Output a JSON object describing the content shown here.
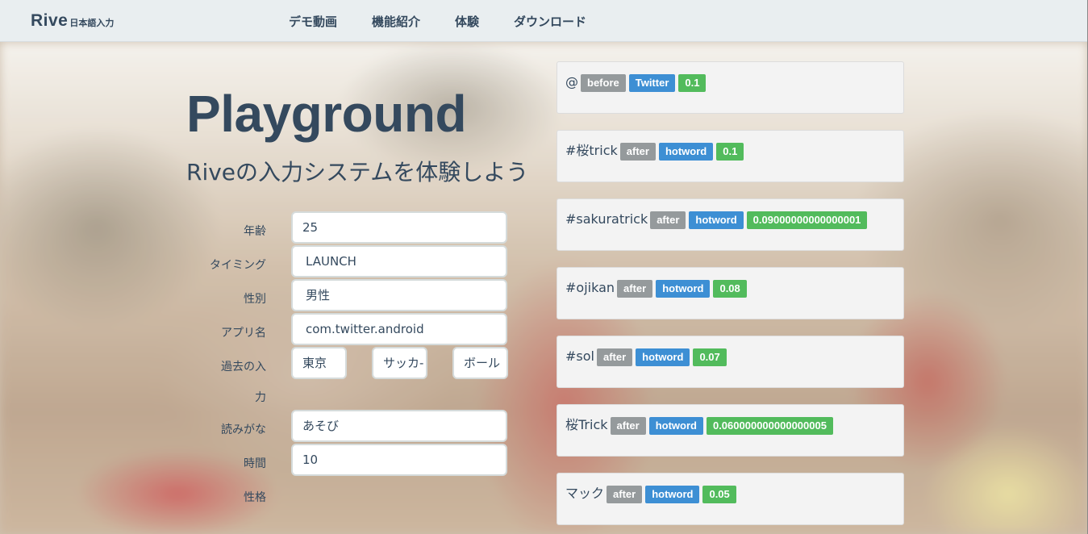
{
  "navbar": {
    "brand": "Rive",
    "brand_sub": "日本語入力",
    "links": [
      "デモ動画",
      "機能紹介",
      "体験",
      "ダウンロード"
    ]
  },
  "hero": {
    "title": "Playground",
    "subtitle": "Riveの入力システムを体験しよう"
  },
  "form": {
    "age_label": "年齢",
    "age_value": "25",
    "timing_label": "タイミング",
    "timing_value": "LAUNCH",
    "gender_label": "性別",
    "gender_value": "男性",
    "app_label": "アプリ名",
    "app_value": "com.twitter.android",
    "history_label_1": "過去の入",
    "history_label_2": "力",
    "history_values": [
      "東京",
      "サッカ-",
      "ボール"
    ],
    "reading_label": "読みがな",
    "reading_value": "あそび",
    "time_label": "時間",
    "time_value": "10",
    "personality_label": "性格"
  },
  "candidates": [
    {
      "word": "@",
      "position": "before",
      "source": "Twitter",
      "score": "0.1"
    },
    {
      "word": "#桜trick",
      "position": "after",
      "source": "hotword",
      "score": "0.1"
    },
    {
      "word": "#sakuratrick",
      "position": "after",
      "source": "hotword",
      "score": "0.09000000000000001"
    },
    {
      "word": "#ojikan",
      "position": "after",
      "source": "hotword",
      "score": "0.08"
    },
    {
      "word": "#sol",
      "position": "after",
      "source": "hotword",
      "score": "0.07"
    },
    {
      "word": "桜Trick",
      "position": "after",
      "source": "hotword",
      "score": "0.060000000000000005"
    },
    {
      "word": "マック",
      "position": "after",
      "source": "hotword",
      "score": "0.05"
    }
  ],
  "colors": {
    "text": "#34495e",
    "tag_position": "#959a9c",
    "tag_source": "#3d8fd4",
    "tag_score": "#52bb5c"
  }
}
